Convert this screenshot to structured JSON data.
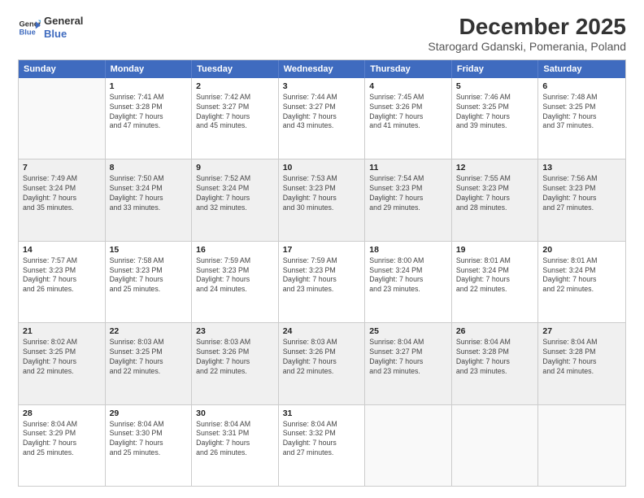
{
  "header": {
    "logo_line1": "General",
    "logo_line2": "Blue",
    "title": "December 2025",
    "subtitle": "Starogard Gdanski, Pomerania, Poland"
  },
  "weekdays": [
    "Sunday",
    "Monday",
    "Tuesday",
    "Wednesday",
    "Thursday",
    "Friday",
    "Saturday"
  ],
  "rows": [
    [
      {
        "day": "",
        "info": "",
        "empty": true
      },
      {
        "day": "1",
        "info": "Sunrise: 7:41 AM\nSunset: 3:28 PM\nDaylight: 7 hours\nand 47 minutes."
      },
      {
        "day": "2",
        "info": "Sunrise: 7:42 AM\nSunset: 3:27 PM\nDaylight: 7 hours\nand 45 minutes."
      },
      {
        "day": "3",
        "info": "Sunrise: 7:44 AM\nSunset: 3:27 PM\nDaylight: 7 hours\nand 43 minutes."
      },
      {
        "day": "4",
        "info": "Sunrise: 7:45 AM\nSunset: 3:26 PM\nDaylight: 7 hours\nand 41 minutes."
      },
      {
        "day": "5",
        "info": "Sunrise: 7:46 AM\nSunset: 3:25 PM\nDaylight: 7 hours\nand 39 minutes."
      },
      {
        "day": "6",
        "info": "Sunrise: 7:48 AM\nSunset: 3:25 PM\nDaylight: 7 hours\nand 37 minutes."
      }
    ],
    [
      {
        "day": "7",
        "info": "Sunrise: 7:49 AM\nSunset: 3:24 PM\nDaylight: 7 hours\nand 35 minutes.",
        "shaded": true
      },
      {
        "day": "8",
        "info": "Sunrise: 7:50 AM\nSunset: 3:24 PM\nDaylight: 7 hours\nand 33 minutes.",
        "shaded": true
      },
      {
        "day": "9",
        "info": "Sunrise: 7:52 AM\nSunset: 3:24 PM\nDaylight: 7 hours\nand 32 minutes.",
        "shaded": true
      },
      {
        "day": "10",
        "info": "Sunrise: 7:53 AM\nSunset: 3:23 PM\nDaylight: 7 hours\nand 30 minutes.",
        "shaded": true
      },
      {
        "day": "11",
        "info": "Sunrise: 7:54 AM\nSunset: 3:23 PM\nDaylight: 7 hours\nand 29 minutes.",
        "shaded": true
      },
      {
        "day": "12",
        "info": "Sunrise: 7:55 AM\nSunset: 3:23 PM\nDaylight: 7 hours\nand 28 minutes.",
        "shaded": true
      },
      {
        "day": "13",
        "info": "Sunrise: 7:56 AM\nSunset: 3:23 PM\nDaylight: 7 hours\nand 27 minutes.",
        "shaded": true
      }
    ],
    [
      {
        "day": "14",
        "info": "Sunrise: 7:57 AM\nSunset: 3:23 PM\nDaylight: 7 hours\nand 26 minutes."
      },
      {
        "day": "15",
        "info": "Sunrise: 7:58 AM\nSunset: 3:23 PM\nDaylight: 7 hours\nand 25 minutes."
      },
      {
        "day": "16",
        "info": "Sunrise: 7:59 AM\nSunset: 3:23 PM\nDaylight: 7 hours\nand 24 minutes."
      },
      {
        "day": "17",
        "info": "Sunrise: 7:59 AM\nSunset: 3:23 PM\nDaylight: 7 hours\nand 23 minutes."
      },
      {
        "day": "18",
        "info": "Sunrise: 8:00 AM\nSunset: 3:24 PM\nDaylight: 7 hours\nand 23 minutes."
      },
      {
        "day": "19",
        "info": "Sunrise: 8:01 AM\nSunset: 3:24 PM\nDaylight: 7 hours\nand 22 minutes."
      },
      {
        "day": "20",
        "info": "Sunrise: 8:01 AM\nSunset: 3:24 PM\nDaylight: 7 hours\nand 22 minutes."
      }
    ],
    [
      {
        "day": "21",
        "info": "Sunrise: 8:02 AM\nSunset: 3:25 PM\nDaylight: 7 hours\nand 22 minutes.",
        "shaded": true
      },
      {
        "day": "22",
        "info": "Sunrise: 8:03 AM\nSunset: 3:25 PM\nDaylight: 7 hours\nand 22 minutes.",
        "shaded": true
      },
      {
        "day": "23",
        "info": "Sunrise: 8:03 AM\nSunset: 3:26 PM\nDaylight: 7 hours\nand 22 minutes.",
        "shaded": true
      },
      {
        "day": "24",
        "info": "Sunrise: 8:03 AM\nSunset: 3:26 PM\nDaylight: 7 hours\nand 22 minutes.",
        "shaded": true
      },
      {
        "day": "25",
        "info": "Sunrise: 8:04 AM\nSunset: 3:27 PM\nDaylight: 7 hours\nand 23 minutes.",
        "shaded": true
      },
      {
        "day": "26",
        "info": "Sunrise: 8:04 AM\nSunset: 3:28 PM\nDaylight: 7 hours\nand 23 minutes.",
        "shaded": true
      },
      {
        "day": "27",
        "info": "Sunrise: 8:04 AM\nSunset: 3:28 PM\nDaylight: 7 hours\nand 24 minutes.",
        "shaded": true
      }
    ],
    [
      {
        "day": "28",
        "info": "Sunrise: 8:04 AM\nSunset: 3:29 PM\nDaylight: 7 hours\nand 25 minutes."
      },
      {
        "day": "29",
        "info": "Sunrise: 8:04 AM\nSunset: 3:30 PM\nDaylight: 7 hours\nand 25 minutes."
      },
      {
        "day": "30",
        "info": "Sunrise: 8:04 AM\nSunset: 3:31 PM\nDaylight: 7 hours\nand 26 minutes."
      },
      {
        "day": "31",
        "info": "Sunrise: 8:04 AM\nSunset: 3:32 PM\nDaylight: 7 hours\nand 27 minutes."
      },
      {
        "day": "",
        "info": "",
        "empty": true
      },
      {
        "day": "",
        "info": "",
        "empty": true
      },
      {
        "day": "",
        "info": "",
        "empty": true
      }
    ]
  ]
}
